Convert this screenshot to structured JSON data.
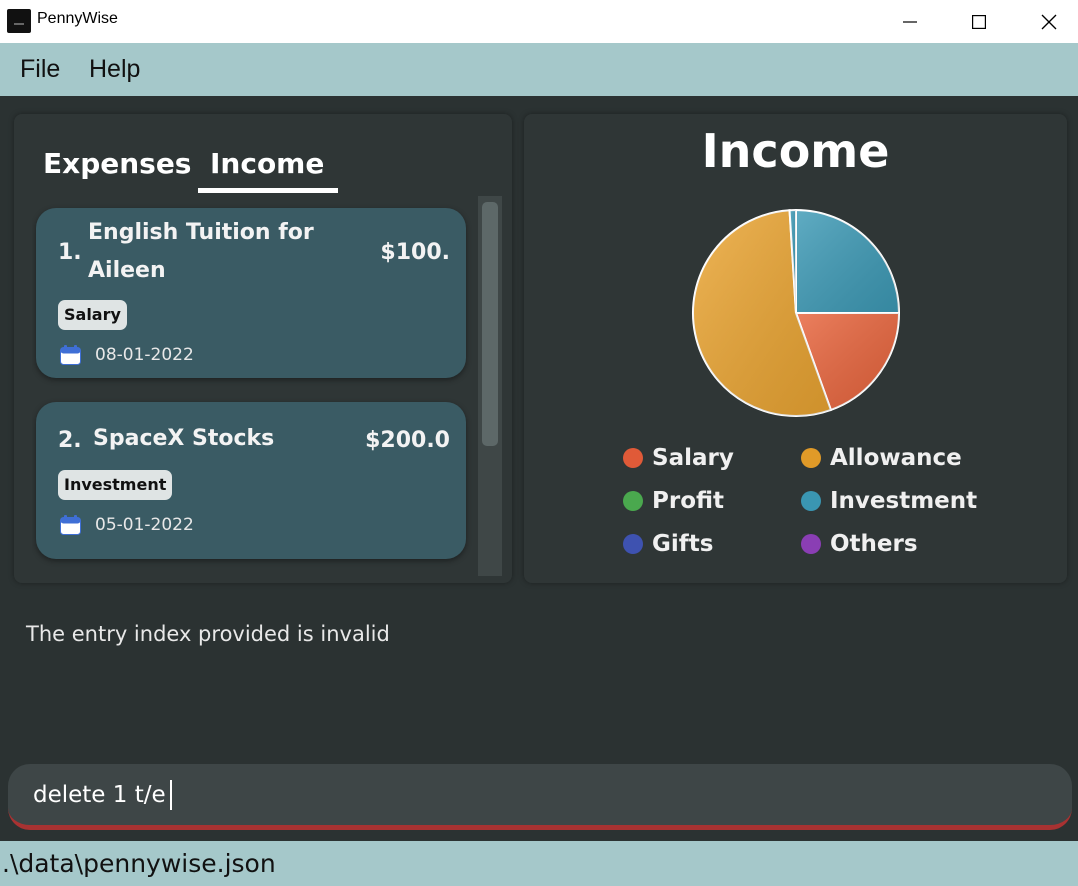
{
  "window": {
    "title": "PennyWise"
  },
  "menu": {
    "file_label": "File",
    "help_label": "Help"
  },
  "tabs": {
    "expenses_label": "Expenses",
    "income_label": "Income",
    "active": "Income"
  },
  "entries": [
    {
      "index": "1.",
      "title_line1": "English Tuition for",
      "title_line2": "Aileen",
      "amount": "$100.",
      "tag": "Salary",
      "date": "08-01-2022",
      "icon": "calendar-icon"
    },
    {
      "index": "2.",
      "title_line1": "SpaceX Stocks",
      "title_line2": "",
      "amount": "$200.0",
      "tag": "Investment",
      "date": "05-01-2022",
      "icon": "calendar-icon"
    }
  ],
  "chart_data": {
    "type": "pie",
    "title": "Income",
    "slices": [
      {
        "label": "Investment",
        "value": 25.0,
        "color": "#3d9ab6"
      },
      {
        "label": "Salary",
        "value": 19.5,
        "color": "#e8643c"
      },
      {
        "label": "Allowance",
        "value": 54.5,
        "color": "#eba532"
      },
      {
        "label": "Others",
        "value": 1.0,
        "color": "#3d9ab6"
      }
    ],
    "legend": [
      {
        "label": "Salary",
        "color": "#e05a38"
      },
      {
        "label": "Allowance",
        "color": "#e09a28"
      },
      {
        "label": "Profit",
        "color": "#4aa84e"
      },
      {
        "label": "Investment",
        "color": "#3a96b2"
      },
      {
        "label": "Gifts",
        "color": "#3e52b0"
      },
      {
        "label": "Others",
        "color": "#8a3eb4"
      }
    ],
    "legend_placement": "bottom"
  },
  "result": {
    "message": "The entry index provided is invalid"
  },
  "command": {
    "value": "delete 1 t/e",
    "error_color": "#a83232"
  },
  "status": {
    "file_path": ".\\data\\pennywise.json"
  }
}
